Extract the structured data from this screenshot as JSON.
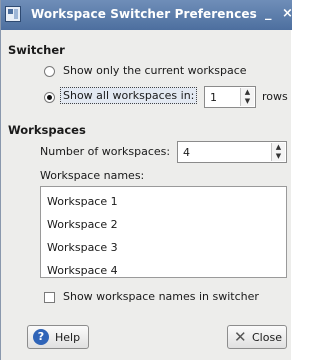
{
  "window": {
    "title": "Workspace Switcher Preferences",
    "minimize_glyph": "_",
    "close_glyph": "×"
  },
  "switcher": {
    "heading": "Switcher",
    "option_current": "Show only the current workspace",
    "option_all": "Show all workspaces in:",
    "rows_value": "1",
    "rows_unit": "rows",
    "selected": "all"
  },
  "workspaces": {
    "heading": "Workspaces",
    "number_label": "Number of workspaces:",
    "number_value": "4",
    "names_label": "Workspace names:",
    "names": [
      "Workspace 1",
      "Workspace 2",
      "Workspace 3",
      "Workspace 4"
    ],
    "show_names_label": "Show workspace names in switcher",
    "show_names_checked": false
  },
  "buttons": {
    "help": "Help",
    "close": "Close"
  },
  "icons": {
    "window_icon": "workspace-switcher-icon",
    "help_icon": "help-icon",
    "close_icon": "close-x-icon"
  }
}
